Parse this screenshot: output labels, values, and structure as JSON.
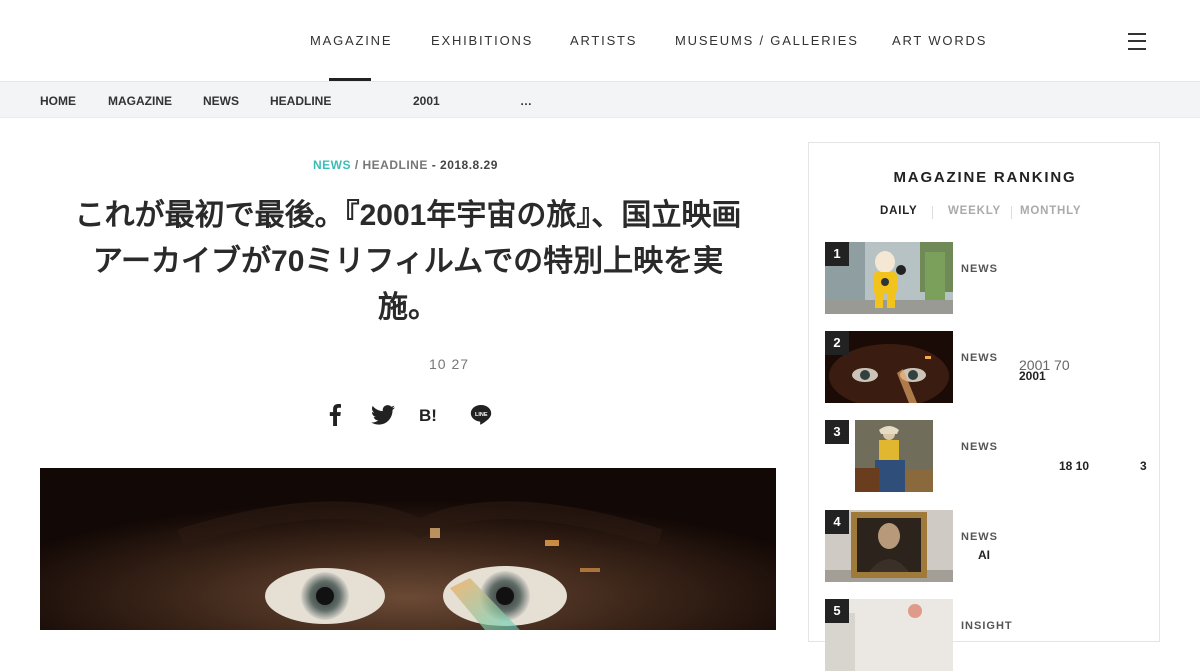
{
  "nav": {
    "items": [
      "MAGAZINE",
      "EXHIBITIONS",
      "ARTISTS",
      "MUSEUMS / GALLERIES",
      "ART WORDS"
    ]
  },
  "breadcrumb": {
    "items": [
      "HOME",
      "MAGAZINE",
      "NEWS",
      "HEADLINE",
      "2001",
      "…"
    ]
  },
  "article": {
    "category": "NEWS",
    "separator": " / ",
    "subcategory": "HEADLINE",
    "date": " - 2018.8.29",
    "title": "これが最初で最後。『2001年宇宙の旅』、国立映画アーカイブが70ミリフィルムでの特別上映を実施。",
    "readtime": "10  27",
    "share_icons": [
      "facebook-icon",
      "twitter-icon",
      "hatena-bookmark-icon",
      "line-icon"
    ]
  },
  "ranking": {
    "title": "MAGAZINE RANKING",
    "tabs": [
      "DAILY",
      "WEEKLY",
      "MONTHLY"
    ],
    "items": [
      {
        "num": "1",
        "category": "NEWS",
        "text1": "",
        "text2": ""
      },
      {
        "num": "2",
        "category": "NEWS",
        "text1": "2001         70",
        "text2": "2001"
      },
      {
        "num": "3",
        "category": "NEWS",
        "text1": "18  10",
        "text2": "3"
      },
      {
        "num": "4",
        "category": "NEWS",
        "text1": "AI",
        "text2": ""
      },
      {
        "num": "5",
        "category": "INSIGHT",
        "text1": "",
        "text2": ""
      }
    ]
  },
  "colors": {
    "accent": "#3dbcb6",
    "text": "#222222",
    "breadcrumb_bg": "#f3f4f5"
  }
}
